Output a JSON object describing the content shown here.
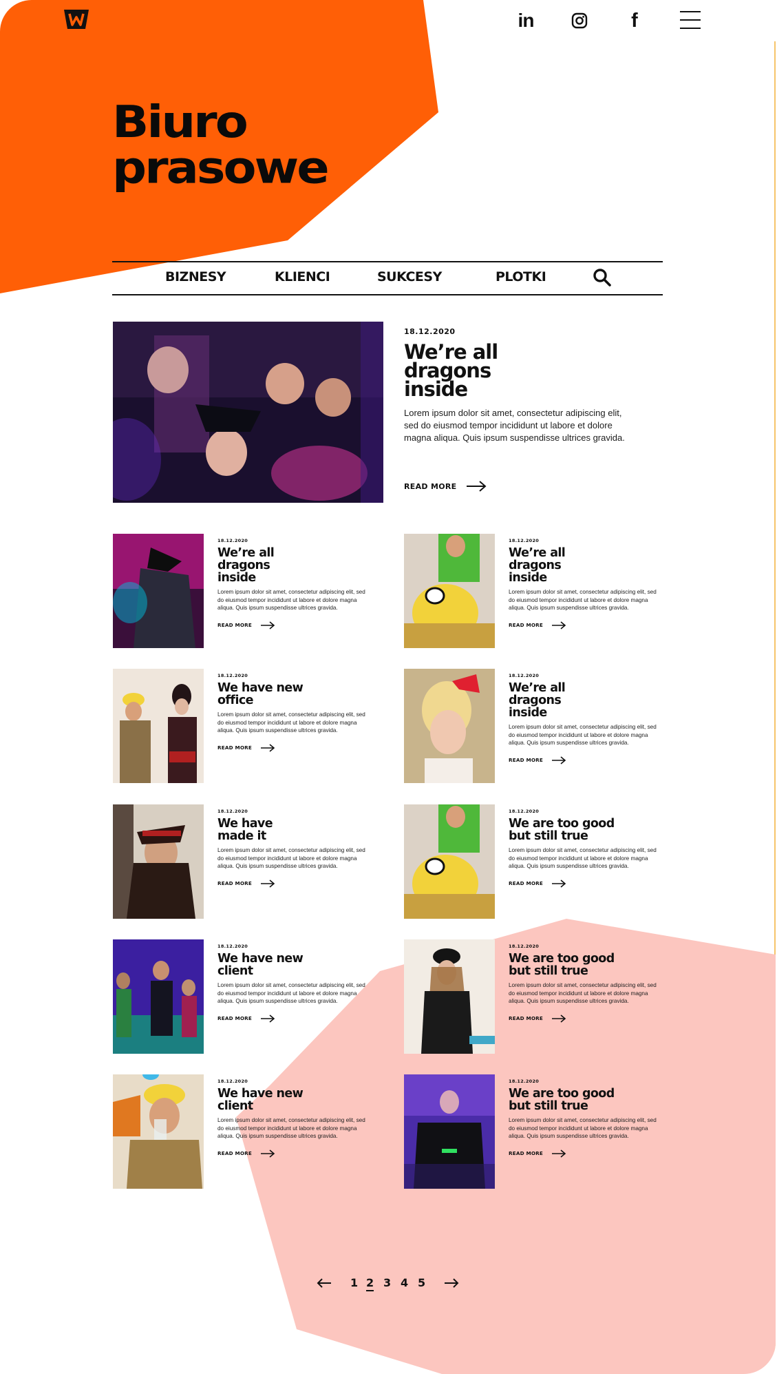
{
  "brand": {
    "logo": "W",
    "accent": "#ff5f06",
    "secondary": "#fcc6bf"
  },
  "topbar": {
    "social": [
      "linkedin-icon",
      "instagram-icon",
      "facebook-icon"
    ],
    "menu_icon": "hamburger-menu-icon"
  },
  "hero": {
    "title_line1": "Biuro",
    "title_line2": "prasowe"
  },
  "nav": {
    "items": [
      "BIZNESY",
      "KLIENCI",
      "SUKCESY",
      "PLOTKI"
    ],
    "search_icon": "search-icon"
  },
  "featured": {
    "date": "18.12.2020",
    "title": "We’re all dragons inside",
    "excerpt": "Lorem ipsum dolor sit amet, consectetur adipiscing elit, sed do eiusmod tempor incididunt ut labore et dolore magna aliqua. Quis ipsum suspendisse ultrices gravida.",
    "read_more": "READ MORE"
  },
  "articles": [
    {
      "date": "18.12.2020",
      "title": "We’re all dragons inside",
      "excerpt": "Lorem ipsum dolor sit amet, consectetur adipiscing elit, sed do eiusmod tempor incididunt ut labore et dolore magna aliqua. Quis ipsum suspendisse ultrices gravida.",
      "read_more": "READ MORE"
    },
    {
      "date": "18.12.2020",
      "title": "We’re all dragons inside",
      "excerpt": "Lorem ipsum dolor sit amet, consectetur adipiscing elit, sed do eiusmod tempor incididunt ut labore et dolore magna aliqua. Quis ipsum suspendisse ultrices gravida.",
      "read_more": "READ MORE"
    },
    {
      "date": "18.12.2020",
      "title": "We have new office",
      "excerpt": "Lorem ipsum dolor sit amet, consectetur adipiscing elit, sed do eiusmod tempor incididunt ut labore et dolore magna aliqua. Quis ipsum suspendisse ultrices gravida.",
      "read_more": "READ MORE"
    },
    {
      "date": "18.12.2020",
      "title": "We’re all dragons inside",
      "excerpt": "Lorem ipsum dolor sit amet, consectetur adipiscing elit, sed do eiusmod tempor incididunt ut labore et dolore magna aliqua. Quis ipsum suspendisse ultrices gravida.",
      "read_more": "READ MORE"
    },
    {
      "date": "18.12.2020",
      "title": "We have made it",
      "excerpt": "Lorem ipsum dolor sit amet, consectetur adipiscing elit, sed do eiusmod tempor incididunt ut labore et dolore magna aliqua. Quis ipsum suspendisse ultrices gravida.",
      "read_more": "READ MORE"
    },
    {
      "date": "18.12.2020",
      "title": "We are too good but still true",
      "excerpt": "Lorem ipsum dolor sit amet, consectetur adipiscing elit, sed do eiusmod tempor incididunt ut labore et dolore magna aliqua. Quis ipsum suspendisse ultrices gravida.",
      "read_more": "READ MORE"
    },
    {
      "date": "18.12.2020",
      "title": "We have new client",
      "excerpt": "Lorem ipsum dolor sit amet, consectetur adipiscing elit, sed do eiusmod tempor incididunt ut labore et dolore magna aliqua. Quis ipsum suspendisse ultrices gravida.",
      "read_more": "READ MORE"
    },
    {
      "date": "18.12.2020",
      "title": "We are too good but still true",
      "excerpt": "Lorem ipsum dolor sit amet, consectetur adipiscing elit, sed do eiusmod tempor incididunt ut labore et dolore magna aliqua. Quis ipsum suspendisse ultrices gravida.",
      "read_more": "READ MORE"
    },
    {
      "date": "18.12.2020",
      "title": "We have new client",
      "excerpt": "Lorem ipsum dolor sit amet, consectetur adipiscing elit, sed do eiusmod tempor incididunt ut labore et dolore magna aliqua. Quis ipsum suspendisse ultrices gravida.",
      "read_more": "READ MORE"
    },
    {
      "date": "18.12.2020",
      "title": "We are too good but still true",
      "excerpt": "Lorem ipsum dolor sit amet, consectetur adipiscing elit, sed do eiusmod tempor incididunt ut labore et dolore magna aliqua. Quis ipsum suspendisse ultrices gravida.",
      "read_more": "READ MORE"
    }
  ],
  "pagination": {
    "pages": [
      "1",
      "2",
      "3",
      "4",
      "5"
    ],
    "current": "2"
  }
}
